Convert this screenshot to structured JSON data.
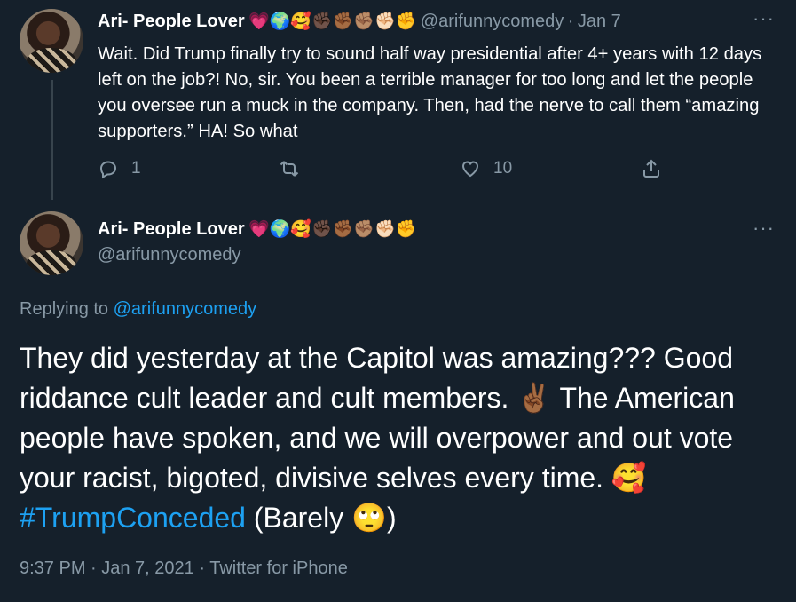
{
  "parent_tweet": {
    "display_name": "Ari- People Lover",
    "name_emojis": "💗🌍🥰✊🏿✊🏾✊🏽✊🏻✊",
    "handle": "@arifunnycomedy",
    "separator": "·",
    "date": "Jan 7",
    "text": "Wait. Did Trump finally try to sound half way presidential after 4+ years with 12 days left on the job?! No, sir. You been a terrible manager for too long and let the people you oversee run a muck in the company. Then, had the nerve to call them “amazing supporters.” HA! So what",
    "reply_count": "1",
    "like_count": "10",
    "more_label": "···"
  },
  "main_tweet": {
    "display_name": "Ari- People Lover",
    "name_emojis": "💗🌍🥰✊🏿✊🏾✊🏽✊🏻✊",
    "handle": "@arifunnycomedy",
    "more_label": "···",
    "replying_label": "Replying to",
    "replying_mention": "@arifunnycomedy",
    "text_part1": "They did yesterday at the Capitol was amazing??? Good riddance cult leader and cult members. ✌🏾 The American people have spoken, and we will overpower and out vote your racist, bigoted, divisive selves every time. 🥰 ",
    "hashtag": "#TrumpConceded",
    "text_part2": " (Barely 🙄)",
    "timestamp": "9:37 PM · Jan 7, 2021 · Twitter for iPhone"
  },
  "icons": {
    "reply": "reply-icon",
    "retweet": "retweet-icon",
    "like": "heart-icon",
    "share": "share-icon",
    "more": "more-icon"
  },
  "colors": {
    "background": "#15202b",
    "text": "#ffffff",
    "muted": "#8899a6",
    "accent": "#1da1f2",
    "divider": "#38444d"
  }
}
